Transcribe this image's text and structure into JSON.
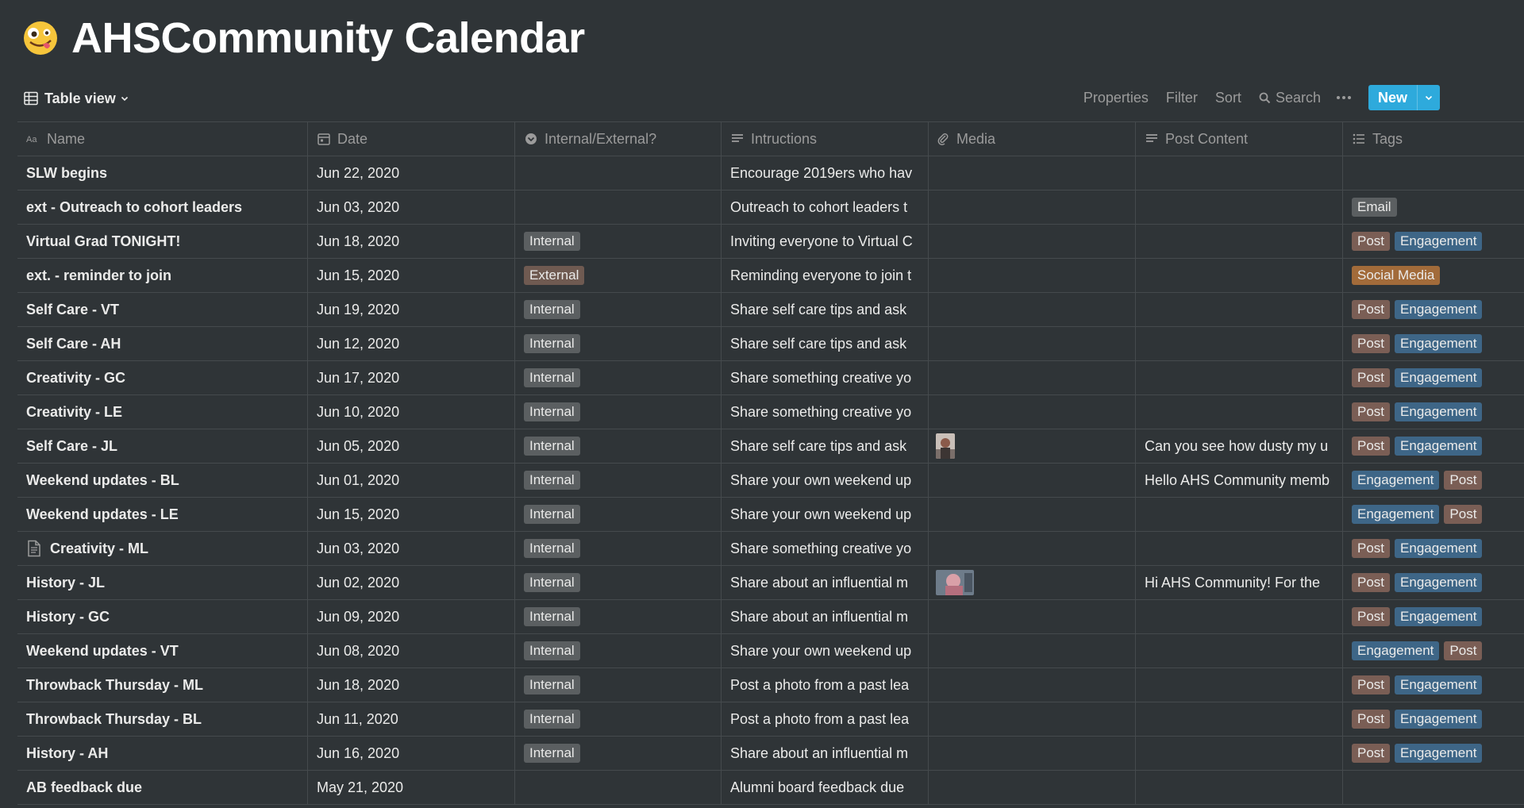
{
  "page": {
    "title": "AHSCommunity Calendar",
    "emoji_icon": "zany-face-emoji"
  },
  "view": {
    "label": "Table view"
  },
  "toolbar": {
    "properties": "Properties",
    "filter": "Filter",
    "sort": "Sort",
    "search": "Search",
    "new": "New"
  },
  "columns": {
    "name": "Name",
    "date": "Date",
    "internal_external": "Internal/External?",
    "instructions": "Intructions",
    "media": "Media",
    "post_content": "Post Content",
    "tags": "Tags"
  },
  "colors": {
    "background": "#2f3437",
    "accent": "#2eaadc",
    "tag_post": "#7a5e55",
    "tag_engagement": "#3e6687",
    "tag_email": "#5b5f61",
    "tag_social_media": "#a26b3a"
  },
  "rows": [
    {
      "name": "SLW begins",
      "date": "Jun 22, 2020",
      "ie": "",
      "instructions": "Encourage 2019ers who hav",
      "media": "",
      "post": "",
      "tags": []
    },
    {
      "name": "ext - Outreach to cohort leaders",
      "date": "Jun 03, 2020",
      "ie": "",
      "instructions": "Outreach to cohort leaders t",
      "media": "",
      "post": "",
      "tags": [
        "Email"
      ]
    },
    {
      "name": "Virtual Grad TONIGHT!",
      "date": "Jun 18, 2020",
      "ie": "Internal",
      "instructions": "Inviting everyone to Virtual C",
      "media": "",
      "post": "",
      "tags": [
        "Post",
        "Engagement"
      ]
    },
    {
      "name": "ext. - reminder to join",
      "date": "Jun 15, 2020",
      "ie": "External",
      "instructions": "Reminding everyone to join t",
      "media": "",
      "post": "",
      "tags": [
        "Social Media"
      ]
    },
    {
      "name": "Self Care - VT",
      "date": "Jun 19, 2020",
      "ie": "Internal",
      "instructions": "Share self care tips and ask",
      "media": "",
      "post": "",
      "tags": [
        "Post",
        "Engagement"
      ]
    },
    {
      "name": "Self Care - AH",
      "date": "Jun 12, 2020",
      "ie": "Internal",
      "instructions": "Share self care tips and ask",
      "media": "",
      "post": "",
      "tags": [
        "Post",
        "Engagement"
      ]
    },
    {
      "name": "Creativity - GC",
      "date": "Jun 17, 2020",
      "ie": "Internal",
      "instructions": "Share something creative yo",
      "media": "",
      "post": "",
      "tags": [
        "Post",
        "Engagement"
      ]
    },
    {
      "name": "Creativity - LE",
      "date": "Jun 10, 2020",
      "ie": "Internal",
      "instructions": "Share something creative yo",
      "media": "",
      "post": "",
      "tags": [
        "Post",
        "Engagement"
      ]
    },
    {
      "name": "Self Care - JL",
      "date": "Jun 05, 2020",
      "ie": "Internal",
      "instructions": "Share self care tips and ask",
      "media": "portrait",
      "post": "Can you see how dusty my u",
      "tags": [
        "Post",
        "Engagement"
      ]
    },
    {
      "name": "Weekend updates - BL",
      "date": "Jun 01, 2020",
      "ie": "Internal",
      "instructions": "Share your own weekend up",
      "media": "",
      "post": "Hello AHS Community memb",
      "tags": [
        "Engagement",
        "Post"
      ]
    },
    {
      "name": "Weekend updates - LE",
      "date": "Jun 15, 2020",
      "ie": "Internal",
      "instructions": "Share your own weekend up",
      "media": "",
      "post": "",
      "tags": [
        "Engagement",
        "Post"
      ]
    },
    {
      "name": "Creativity - ML",
      "date": "Jun 03, 2020",
      "ie": "Internal",
      "instructions": "Share something creative yo",
      "media": "",
      "post": "",
      "tags": [
        "Post",
        "Engagement"
      ],
      "page_icon": true
    },
    {
      "name": "History - JL",
      "date": "Jun 02, 2020",
      "ie": "Internal",
      "instructions": "Share about an influential m",
      "media": "landscape",
      "post": "Hi AHS Community! For the",
      "tags": [
        "Post",
        "Engagement"
      ]
    },
    {
      "name": "History - GC",
      "date": "Jun 09, 2020",
      "ie": "Internal",
      "instructions": "Share about an influential m",
      "media": "",
      "post": "",
      "tags": [
        "Post",
        "Engagement"
      ]
    },
    {
      "name": "Weekend updates - VT",
      "date": "Jun 08, 2020",
      "ie": "Internal",
      "instructions": "Share your own weekend up",
      "media": "",
      "post": "",
      "tags": [
        "Engagement",
        "Post"
      ]
    },
    {
      "name": "Throwback Thursday - ML",
      "date": "Jun 18, 2020",
      "ie": "Internal",
      "instructions": "Post a photo from a past lea",
      "media": "",
      "post": "",
      "tags": [
        "Post",
        "Engagement"
      ]
    },
    {
      "name": "Throwback Thursday - BL",
      "date": "Jun 11, 2020",
      "ie": "Internal",
      "instructions": "Post a photo from a past lea",
      "media": "",
      "post": "",
      "tags": [
        "Post",
        "Engagement"
      ]
    },
    {
      "name": "History - AH",
      "date": "Jun 16, 2020",
      "ie": "Internal",
      "instructions": "Share about an influential m",
      "media": "",
      "post": "",
      "tags": [
        "Post",
        "Engagement"
      ]
    },
    {
      "name": "AB feedback due",
      "date": "May 21, 2020",
      "ie": "",
      "instructions": "Alumni board feedback due",
      "media": "",
      "post": "",
      "tags": []
    }
  ]
}
